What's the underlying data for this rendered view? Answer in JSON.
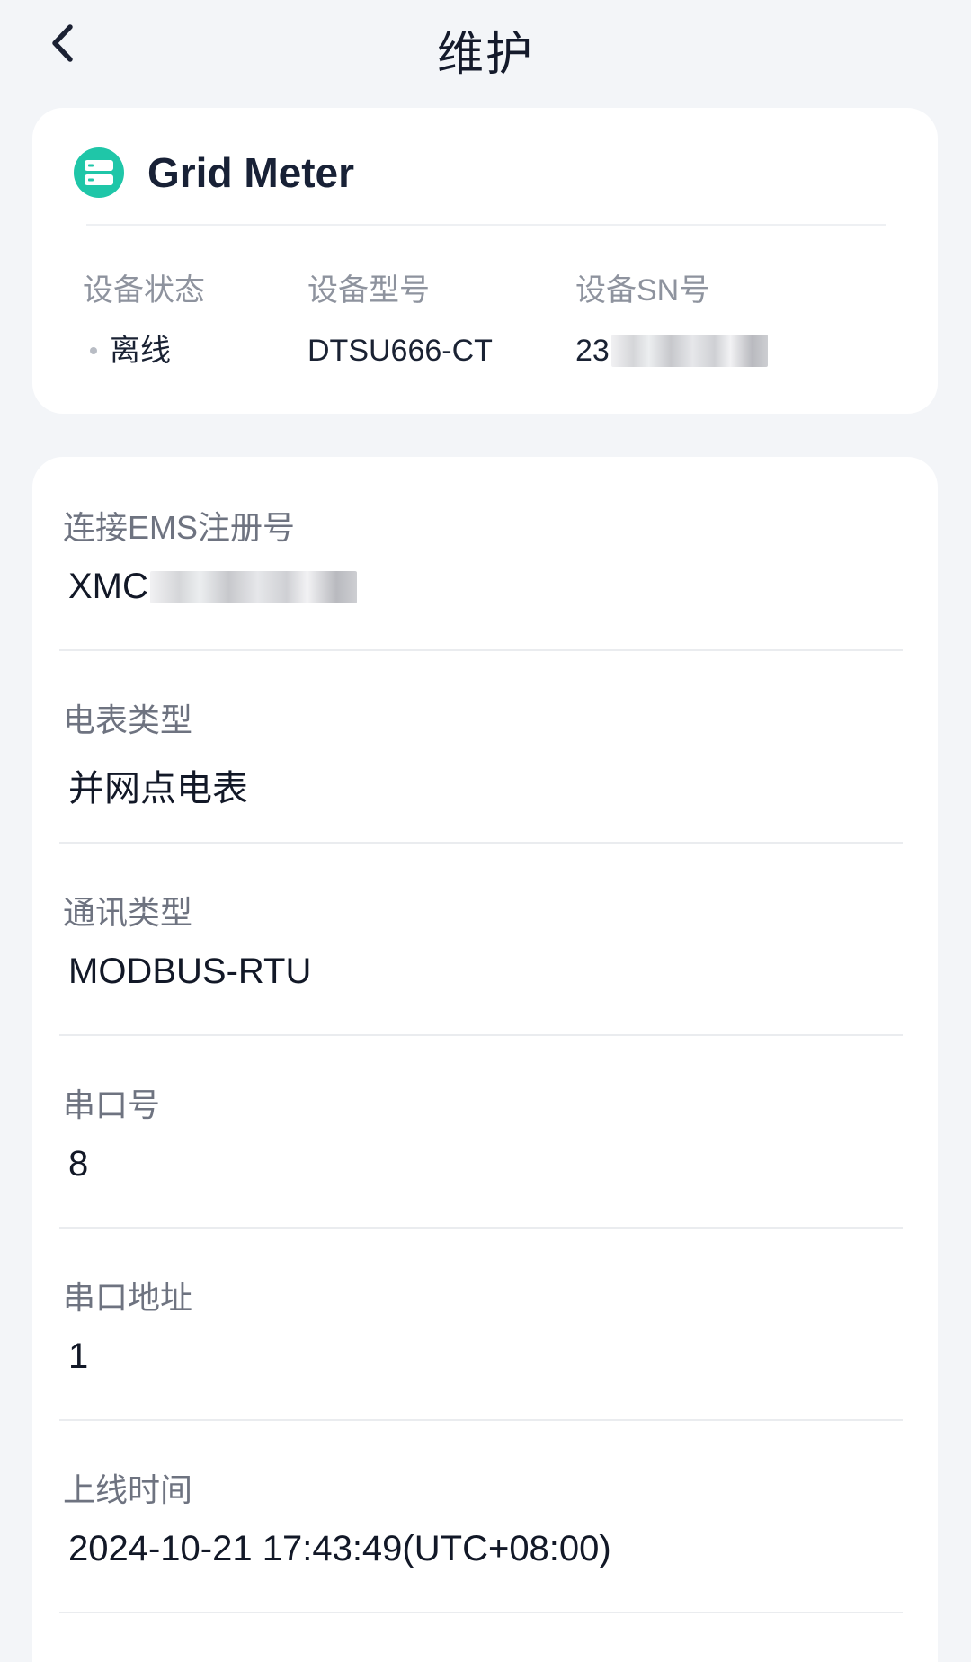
{
  "header": {
    "title": "维护",
    "back_icon": "chevron-left-icon"
  },
  "device": {
    "name": "Grid Meter",
    "icon": "server-icon",
    "icon_color": "#1fc6a8",
    "status_label": "设备状态",
    "status_value": "离线",
    "model_label": "设备型号",
    "model_value": "DTSU666-CT",
    "sn_label": "设备SN号",
    "sn_value_visible": "23"
  },
  "details": {
    "ems": {
      "label": "连接EMS注册号",
      "value_visible": "XMC"
    },
    "meter_type": {
      "label": "电表类型",
      "value": "并网点电表"
    },
    "comm_type": {
      "label": "通讯类型",
      "value": "MODBUS-RTU"
    },
    "serial_port": {
      "label": "串口号",
      "value": "8"
    },
    "serial_address": {
      "label": "串口地址",
      "value": "1"
    },
    "online_time": {
      "label": "上线时间",
      "value": "2024-10-21 17:43:49(UTC+08:00)"
    }
  }
}
